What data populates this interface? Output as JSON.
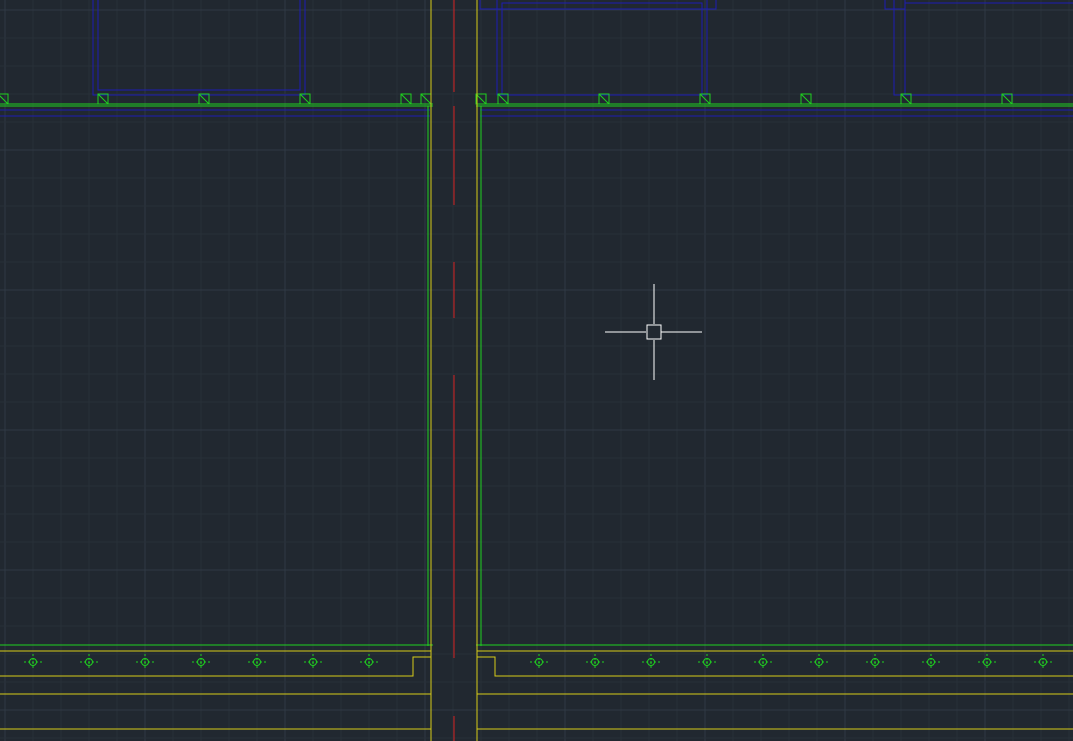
{
  "app": {
    "type": "cad-model-space",
    "view": "plan drawing"
  },
  "colors": {
    "background": "#212830",
    "grid_minor": "#283038",
    "grid_major": "#2F3944",
    "blue_layer": "#1D1DB3",
    "green_layer": "#1FD21F",
    "yellow_layer": "#D6CC18",
    "red_centerline": "#D42020",
    "crosshair": "#FFFFFF"
  },
  "icons": {
    "crosshair": "crosshair-cursor-icon",
    "small_marker": "crossed-square-marker-icon",
    "fixture": "circle-crosshair-fixture-icon"
  }
}
